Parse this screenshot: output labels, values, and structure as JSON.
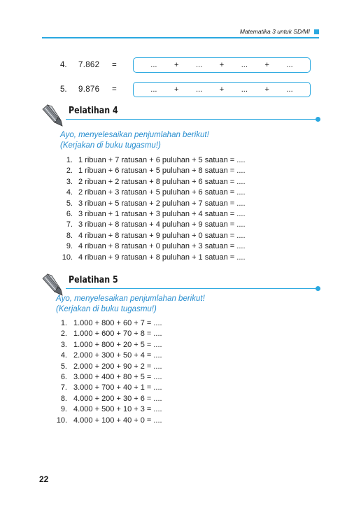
{
  "header": {
    "running_title": "Matematika 3 untuk SD/MI"
  },
  "top_questions": [
    {
      "number": "4.",
      "value": "7.862",
      "equals": "=",
      "blank": "...",
      "plus": "+"
    },
    {
      "number": "5.",
      "value": "9.876",
      "equals": "=",
      "blank": "...",
      "plus": "+"
    }
  ],
  "pelatihan4": {
    "title": "Pelatihan 4",
    "instruction": "Ayo, menyelesaikan penjumlahan berikut!",
    "instruction_note": "(Kerjakan di buku tugasmu!)",
    "items": [
      {
        "n": "1.",
        "text": "1 ribuan + 7 ratusan + 6 puluhan + 5 satuan = ...."
      },
      {
        "n": "2.",
        "text": "1 ribuan + 6 ratusan + 5 puluhan + 8 satuan = ...."
      },
      {
        "n": "3.",
        "text": "2 ribuan + 2 ratusan + 8 puluhan + 6 satuan = ...."
      },
      {
        "n": "4.",
        "text": "2 ribuan + 3 ratusan + 5 puluhan + 6 satuan = ...."
      },
      {
        "n": "5.",
        "text": "3 ribuan + 5 ratusan + 2 puluhan + 7 satuan = ...."
      },
      {
        "n": "6.",
        "text": "3 ribuan + 1 ratusan + 3 puluhan + 4 satuan = ...."
      },
      {
        "n": "7.",
        "text": "3 ribuan + 8 ratusan + 4 puluhan + 9 satuan = ...."
      },
      {
        "n": "8.",
        "text": "4 ribuan + 8 ratusan + 9 puluhan + 0 satuan = ...."
      },
      {
        "n": "9.",
        "text": "4 ribuan + 8 ratusan + 0 puluhan + 3 satuan = ...."
      },
      {
        "n": "10.",
        "text": "4 ribuan + 9 ratusan + 8 puluhan + 1 satuan = ...."
      }
    ]
  },
  "pelatihan5": {
    "title": "Pelatihan 5",
    "instruction": "Ayo, menyelesaikan penjumlahan berikut!",
    "instruction_note": "(Kerjakan di buku tugasmu!)",
    "items": [
      {
        "n": "1.",
        "text": "1.000 + 800 + 60 + 7 = ...."
      },
      {
        "n": "2.",
        "text": "1.000 + 600 + 70 + 8 = ...."
      },
      {
        "n": "3.",
        "text": "1.000 + 800 + 20 + 5 = ...."
      },
      {
        "n": "4.",
        "text": "2.000 + 300 + 50 + 4 = ...."
      },
      {
        "n": "5.",
        "text": "2.000 + 200 + 90 + 2 = ...."
      },
      {
        "n": "6.",
        "text": "3.000 + 400 + 80 + 5 = ...."
      },
      {
        "n": "7.",
        "text": "3.000 + 700 + 40 + 1 = ...."
      },
      {
        "n": "8.",
        "text": "4.000 + 200 + 30 + 6 = ...."
      },
      {
        "n": "9.",
        "text": "4.000 + 500 + 10 + 3 = ...."
      },
      {
        "n": "10.",
        "text": "4.000 + 100 + 40 + 0 = ...."
      }
    ]
  },
  "page_number": "22",
  "colors": {
    "accent": "#2aa8e0",
    "instruction": "#2a8fd0",
    "text": "#1a1a1a"
  },
  "icons": {
    "section_icon": "pencil-icon"
  }
}
